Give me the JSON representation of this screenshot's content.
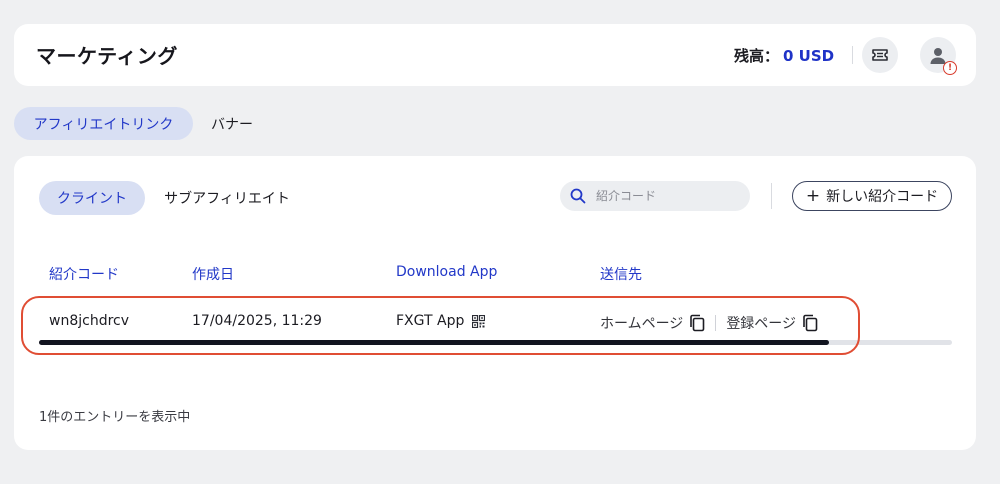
{
  "header": {
    "title": "マーケティング",
    "balance_label": "残高：",
    "balance_value": "0 USD",
    "icons": {
      "ticket": "ticket-icon",
      "user": "user-icon",
      "alert": "alert-icon"
    },
    "alert_glyph": "!"
  },
  "top_tabs": [
    {
      "label": "アフィリエイトリンク",
      "active": true
    },
    {
      "label": "バナー",
      "active": false
    }
  ],
  "sub_tabs": [
    {
      "label": "クライント",
      "active": true
    },
    {
      "label": "サブアフィリエイト",
      "active": false
    }
  ],
  "search": {
    "placeholder": "紹介コード",
    "value": ""
  },
  "new_button": {
    "plus": "+",
    "label": "新しい紹介コード"
  },
  "table": {
    "columns": [
      "紹介コード",
      "作成日",
      "Download App",
      "送信先"
    ],
    "rows": [
      {
        "code": "wn8jchdrcv",
        "created": "17/04/2025, 11:29",
        "app": "FXGT App",
        "targets": [
          "ホームページ",
          "登録ページ"
        ]
      }
    ]
  },
  "scroll_position": 0.865,
  "footer": {
    "entries_text": "1件のエントリーを表示中"
  },
  "colors": {
    "accent": "#2238c8",
    "balance": "#1f33c7",
    "highlight": "#e04d34",
    "active_tab_bg": "#d8dff3"
  }
}
